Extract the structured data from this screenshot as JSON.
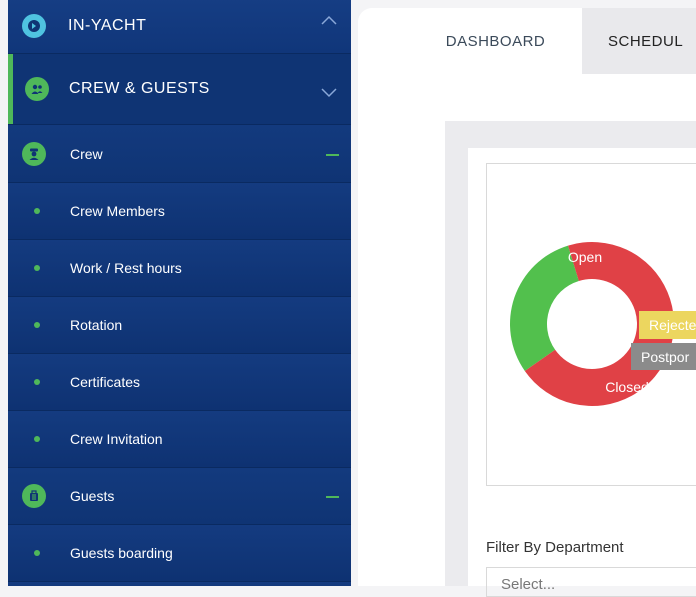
{
  "sidebar": {
    "top": {
      "label": "IN-YACHT"
    },
    "section": {
      "label": "CREW & GUESTS"
    },
    "crew": {
      "label": "Crew"
    },
    "crew_items": [
      {
        "label": "Crew Members"
      },
      {
        "label": "Work / Rest hours"
      },
      {
        "label": "Rotation"
      },
      {
        "label": "Certificates"
      },
      {
        "label": "Crew Invitation"
      }
    ],
    "guests": {
      "label": "Guests"
    },
    "guest_items": [
      {
        "label": "Guests boarding"
      }
    ]
  },
  "tabs": [
    {
      "label": "DASHBOARD"
    },
    {
      "label": "SCHEDUL"
    }
  ],
  "chart_data": {
    "type": "pie",
    "labels": [
      "Open",
      "Closed",
      "Rejected",
      "Postponed"
    ],
    "visible_labels": [
      "Open",
      "Closed",
      "Rejecte",
      "Postpor"
    ],
    "values": [
      70,
      30,
      0,
      0
    ],
    "colors": [
      "#e04146",
      "#52c04d",
      "#ecd65f",
      "#8b8b8b"
    ]
  },
  "filter": {
    "label": "Filter By Department",
    "placeholder": "Select..."
  },
  "colors": {
    "sidebar_bg": "#0f3474",
    "accent_green": "#4fb85a",
    "highlight_cyan": "#4fc3e0"
  }
}
